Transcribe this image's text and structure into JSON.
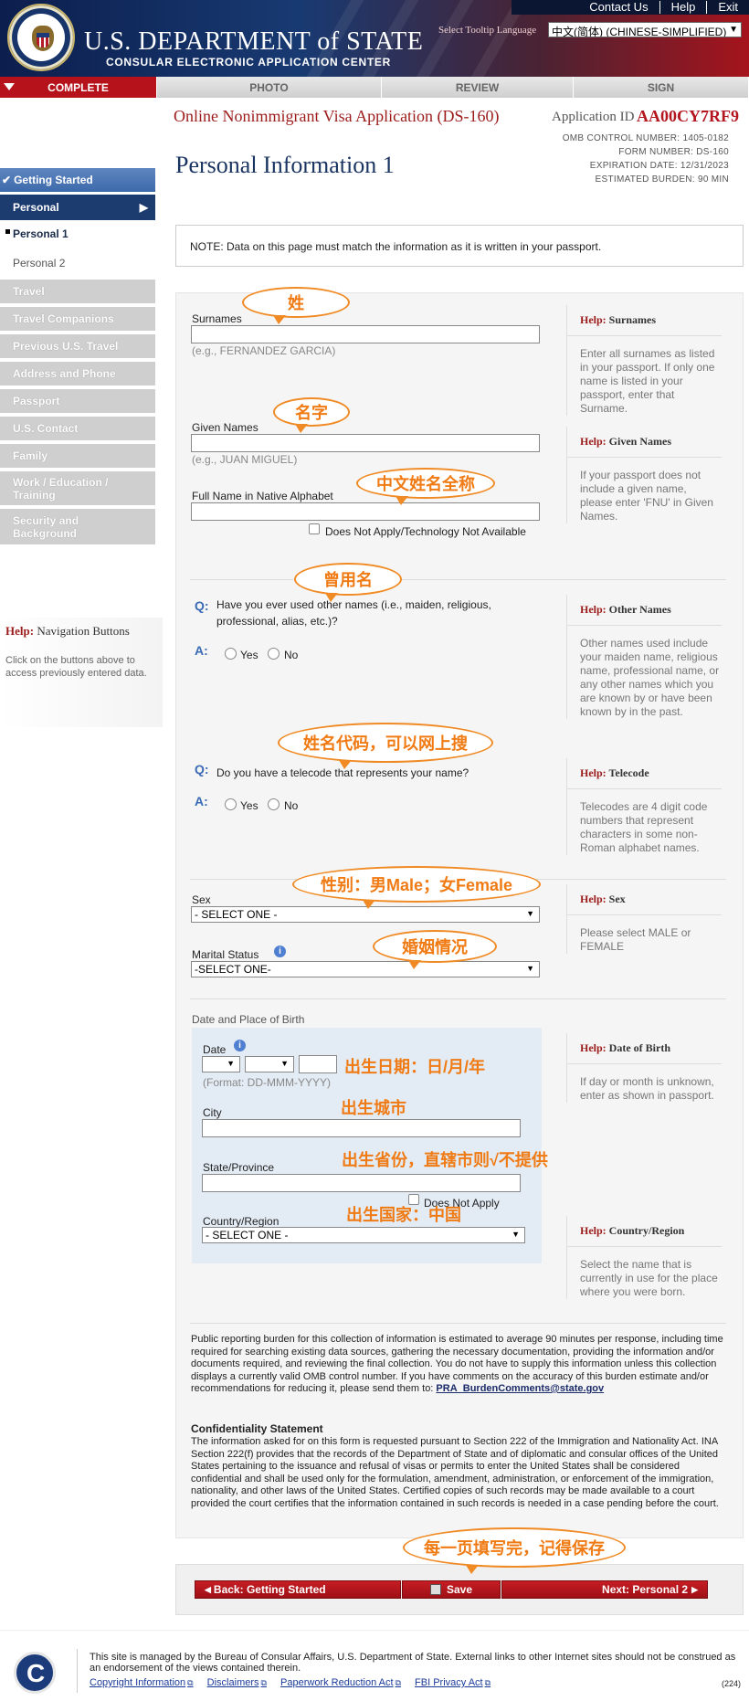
{
  "header": {
    "top_links": [
      "Contact Us",
      "Help",
      "Exit"
    ],
    "department": "U.S. DEPARTMENT of STATE",
    "subtitle": "CONSULAR ELECTRONIC APPLICATION CENTER",
    "tooltip_language_label": "Select Tooltip Language",
    "tooltip_language_value": "中文(简体)  (CHINESE-SIMPLIFIED)"
  },
  "tabs": [
    "COMPLETE",
    "PHOTO",
    "REVIEW",
    "SIGN"
  ],
  "form": {
    "title": "Online Nonimmigrant Visa Application (DS-160)",
    "app_id_label": "Application ID",
    "app_id": "AA00CY7RF9",
    "omb": [
      "OMB CONTROL NUMBER:    1405-0182",
      "FORM NUMBER:        DS-160",
      "EXPIRATION DATE:  12/31/2023",
      "ESTIMATED BURDEN:        90 MIN"
    ],
    "page_title": "Personal Information 1"
  },
  "sidebar": {
    "getting_started": "Getting Started",
    "personal": "Personal",
    "personal1": "Personal 1",
    "personal2": "Personal 2",
    "items": [
      "Travel",
      "Travel Companions",
      "Previous U.S. Travel",
      "Address and Phone",
      "Passport",
      "U.S. Contact",
      "Family",
      "Work / Education / Training",
      "Security and Background"
    ],
    "help_prefix": "Help:",
    "help_title": "Navigation Buttons",
    "help_text": "Click on the buttons above to access previously entered data."
  },
  "note": "NOTE: Data on this page must match the information as it is written in your passport.",
  "fields": {
    "surnames": "Surnames",
    "surnames_example": "(e.g., FERNANDEZ GARCIA)",
    "given_names": "Given Names",
    "given_names_example": "(e.g., JUAN MIGUEL)",
    "full_name_native": "Full Name in Native Alphabet",
    "does_not_apply_tech": "Does Not Apply/Technology Not Available",
    "q_other_names": "Have you ever used other names (i.e., maiden, religious, professional, alias, etc.)?",
    "q_telecode": "Do you have a telecode that represents your name?",
    "q_marker": "Q:",
    "a_marker": "A:",
    "yes": "Yes",
    "no": "No",
    "sex": "Sex",
    "sex_value": "- SELECT ONE -",
    "marital": "Marital Status",
    "marital_value": "-SELECT ONE-",
    "dob_heading": "Date and Place of Birth",
    "date": "Date",
    "date_format": "(Format: DD-MMM-YYYY)",
    "city": "City",
    "state": "State/Province",
    "does_not_apply": "Does Not Apply",
    "country": "Country/Region",
    "country_value": "- SELECT ONE -"
  },
  "help_panels": [
    {
      "title": "Surnames",
      "text": "Enter all surnames as listed in your passport. If only one name is listed in your passport, enter that Surname."
    },
    {
      "title": "Given Names",
      "text": "If your passport does not include a given name, please enter 'FNU' in Given Names."
    },
    {
      "title": "Other Names",
      "text": "Other names used include your maiden name, religious name, professional name, or any other names which you are known by or have been known by in the past."
    },
    {
      "title": "Telecode",
      "text": "Telecodes are 4 digit code numbers that represent characters in some non-Roman alphabet names."
    },
    {
      "title": "Sex",
      "text": "Please select MALE or FEMALE"
    },
    {
      "title": "Date of Birth",
      "text": "If day or month is unknown, enter as shown in passport."
    },
    {
      "title": "Country/Region",
      "text": "Select the name that is currently in use for the place where you were born."
    }
  ],
  "help_prefix": "Help:",
  "burden": {
    "text": "Public reporting burden for this collection of information is estimated to average 90 minutes per response, including time required for searching existing data sources, gathering the necessary documentation, providing the information and/or documents required, and reviewing the final collection. You do not have to supply this information unless this collection displays a currently valid OMB control number. If you have comments on the accuracy of this burden estimate and/or recommendations for reducing it, please send them to: ",
    "email": "PRA_BurdenComments@state.gov"
  },
  "confidentiality": {
    "title": "Confidentiality Statement",
    "text": "The information asked for on this form is requested pursuant to Section 222 of the Immigration and Nationality Act. INA Section 222(f) provides that the records of the Department of State and of diplomatic and consular offices of the United States pertaining to the issuance and refusal of visas or permits to enter the United States shall be considered confidential and shall be used only for the formulation, amendment, administration, or enforcement of the immigration, nationality, and other laws of the United States. Certified copies of such records may be made available to a court provided the court certifies that the information contained in such records is needed in a case pending before the court."
  },
  "buttons": {
    "back": "Back: Getting Started",
    "save": "Save",
    "next": "Next: Personal 2"
  },
  "annotations": {
    "surname": "姓",
    "given": "名字",
    "native": "中文姓名全称",
    "other_names": "曾用名",
    "telecode": "姓名代码，可以网上搜",
    "sex": "性别：男Male；女Female",
    "marital": "婚姻情况",
    "date": "出生日期：日/月/年",
    "city": "出生城市",
    "state": "出生省份，直辖市则√不提供",
    "country": "出生国家：中国",
    "save": "每一页填写完，记得保存"
  },
  "footer": {
    "logo_letter": "C",
    "text": "This site is managed by the Bureau of Consular Affairs, U.S. Department of State. External links to other Internet sites should not be construed as an endorsement of the views contained therein.",
    "links": [
      "Copyright Information",
      "Disclaimers",
      "Paperwork Reduction Act",
      "FBI Privacy Act"
    ],
    "code": "(224)"
  }
}
